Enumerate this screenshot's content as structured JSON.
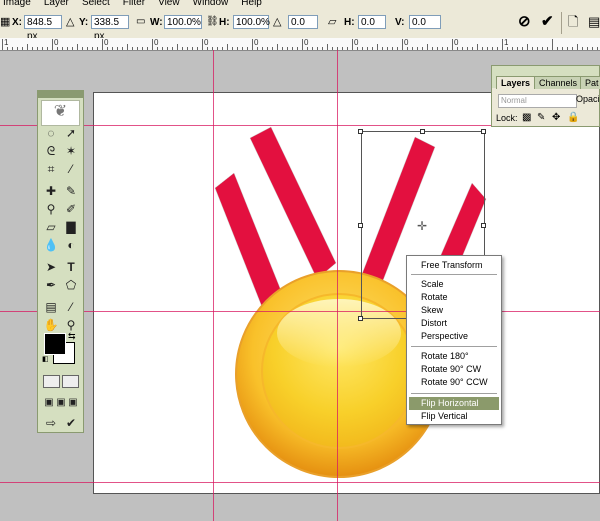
{
  "menu": [
    "Image",
    "Layer",
    "Select",
    "Filter",
    "View",
    "Window",
    "Help"
  ],
  "options": {
    "x_label": "X:",
    "x_value": "848.5 px",
    "y_label": "Y:",
    "y_value": "338.5 px",
    "w_label": "W:",
    "w_value": "100.0%",
    "h_label": "H:",
    "h_value": "100.0%",
    "rot_value": "0.0",
    "hskew_label": "H:",
    "hskew_value": "0.0",
    "vskew_label": "V:",
    "vskew_value": "0.0"
  },
  "ruler_labels": [
    "1",
    "0",
    "0",
    "0",
    "0",
    "0",
    "0",
    "0",
    "0",
    "0",
    "1"
  ],
  "layers_panel": {
    "tabs": [
      "Layers",
      "Channels",
      "Pat"
    ],
    "blend_mode": "Normal",
    "opacity_label": "Opaci",
    "lock_label": "Lock:"
  },
  "context_menu": {
    "items": [
      "Free Transform",
      "Scale",
      "Rotate",
      "Skew",
      "Distort",
      "Perspective",
      "Rotate 180°",
      "Rotate 90° CW",
      "Rotate 90° CCW",
      "Flip Horizontal",
      "Flip Vertical"
    ],
    "highlighted": "Flip Horizontal"
  },
  "colors": {
    "ribbon": "#e3103f",
    "medal_outer": "#f3a41d",
    "medal_inner": "#f7cf1a",
    "guide": "#d81860",
    "highlight": "#8b9a6b"
  },
  "icons": [
    "feather-icon",
    "marquee-tool-icon",
    "move-tool-icon",
    "lasso-tool-icon",
    "magic-wand-tool-icon",
    "crop-tool-icon",
    "eyedropper-tool-icon",
    "healing-brush-tool-icon",
    "brush-tool-icon",
    "clone-stamp-tool-icon",
    "history-brush-tool-icon",
    "eraser-tool-icon",
    "gradient-tool-icon",
    "blur-tool-icon",
    "dodge-tool-icon",
    "path-selection-tool-icon",
    "type-tool-icon",
    "pen-tool-icon",
    "shape-tool-icon",
    "notes-tool-icon",
    "eyedropper2-tool-icon",
    "hand-tool-icon",
    "zoom-tool-icon",
    "cancel-icon",
    "commit-icon"
  ]
}
